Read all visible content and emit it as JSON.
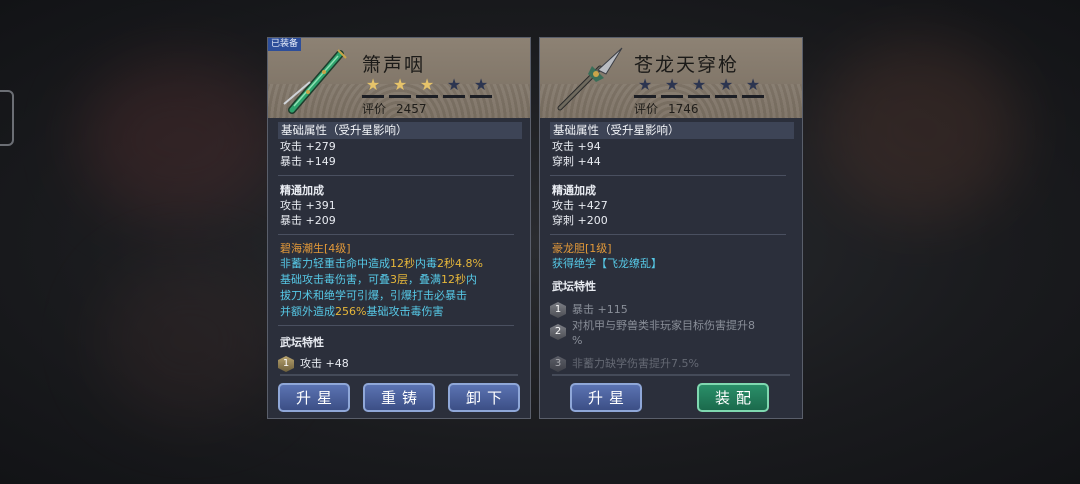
{
  "left": {
    "equipped_tag": "已装备",
    "name": "箫声咽",
    "stars_filled": 3,
    "stars_total": 5,
    "rating_label": "评价",
    "rating_value": "2457",
    "base_title": "基础属性（受升星影响）",
    "base_stats": [
      "攻击 +279",
      "暴击 +149"
    ],
    "mastery_title": "精通加成",
    "mastery_stats": [
      "攻击 +391",
      "暴击 +209"
    ],
    "skill_name": "碧海潮生[4级]",
    "skill_desc": {
      "l1a": "非蓄力轻重击命中造成",
      "l1b": "12秒",
      "l1c": "内毒",
      "l1d": "2秒",
      "l1e": "4.8%",
      "l2a": "基础攻击毒伤害，可叠",
      "l2b": "3层",
      "l2c": "，叠满",
      "l2d": "12秒",
      "l2e": "内",
      "l3": "拔刀术和绝学可引爆，引爆打击必暴击",
      "l4a": "并额外造成",
      "l4b": "256%",
      "l4c": "基础攻击毒伤害"
    },
    "trait_title": "武坛特性",
    "traits": [
      {
        "num": "1",
        "text": "攻击 +48"
      }
    ],
    "buttons": [
      "升星",
      "重铸",
      "卸下"
    ]
  },
  "right": {
    "name": "苍龙天穿枪",
    "stars_filled": 0,
    "stars_total": 5,
    "rating_label": "评价",
    "rating_value": "1746",
    "base_title": "基础属性（受升星影响）",
    "base_stats": [
      "攻击 +94",
      "穿刺 +44"
    ],
    "mastery_title": "精通加成",
    "mastery_stats": [
      "攻击 +427",
      "穿刺 +200"
    ],
    "skill_name": "豪龙胆[1级]",
    "skill_desc_a": "获得绝学",
    "skill_desc_b": "【飞龙缭乱】",
    "trait_title": "武坛特性",
    "traits": [
      {
        "num": "1",
        "text": "暴击 +115"
      },
      {
        "num": "2",
        "text": "对机甲与野兽类非玩家目标伤害提升8",
        "text2": "%"
      },
      {
        "num": "3",
        "text": "非蓄力缺学伤害提升7.5%"
      }
    ],
    "buttons": [
      "升星",
      "装配"
    ]
  },
  "colors": {
    "panel_bg": "#2b2f3b",
    "header_bg": "#8d8274",
    "skill_orange": "#e49a39",
    "skill_cyan": "#56c8e6",
    "highlight_gold": "#e6b73a",
    "star_gold": "#e6c36a",
    "button_blue": "#4a62a0",
    "button_green": "#238060"
  },
  "icons": {
    "left_weapon": "jade-flute-sword-icon",
    "right_weapon": "spear-icon"
  }
}
